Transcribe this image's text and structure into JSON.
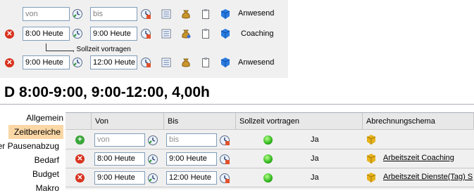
{
  "top_panel": {
    "rows": [
      {
        "von": "von",
        "bis": "bis",
        "label": "Anwesend",
        "deletable": false,
        "von_placeholder": true
      },
      {
        "von": "8:00 Heute",
        "bis": "9:00 Heute",
        "label": "Coaching",
        "deletable": true,
        "von_placeholder": false
      },
      {
        "von": "9:00 Heute",
        "bis": "12:00 Heute",
        "label": "Anwesend",
        "deletable": true,
        "von_placeholder": false
      }
    ],
    "sollzeit_hint": ", Sollzeit vortragen"
  },
  "page_title": "D 8:00-9:00, 9:00-12:00, 4,00h",
  "nav": {
    "items": [
      "Allgemein",
      "Zeitbereiche",
      "er Pausenabzug",
      "Bedarf",
      "Budget",
      "Makro"
    ],
    "active": "Zeitbereiche"
  },
  "grid": {
    "headers": [
      "Von",
      "Bis",
      "Sollzeit vortragen",
      "Abrechnungschema"
    ],
    "rows": [
      {
        "von": "von",
        "bis": "bis",
        "sollzeit": "Ja",
        "schema": "",
        "action": "add"
      },
      {
        "von": "8:00 Heute",
        "bis": "9:00 Heute",
        "sollzeit": "Ja",
        "schema": "Arbeitszeit Coaching",
        "action": "delete"
      },
      {
        "von": "9:00 Heute",
        "bis": "12:00 Heute",
        "sollzeit": "Ja",
        "schema": "Arbeitszeit Dienste(Tag)  S",
        "action": "delete"
      }
    ]
  },
  "colors": {
    "accent_tab": "#fbd7a6",
    "delete": "#d8321e",
    "add": "#3aa63a"
  }
}
